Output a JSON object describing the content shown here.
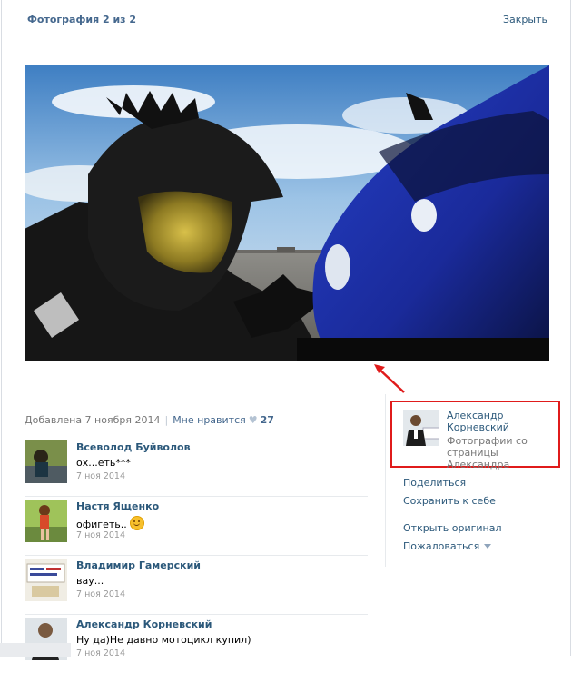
{
  "header": {
    "title": "Фотография 2 из 2",
    "close_label": "Закрыть"
  },
  "meta": {
    "added": "Добавлена 7 ноября 2014",
    "like_label": "Мне нравится",
    "like_count": "27",
    "heart_icon": "heart-icon"
  },
  "comments": [
    {
      "name": "Всеволод Буйволов",
      "text": "ох...еть***",
      "date": "7 ноя 2014"
    },
    {
      "name": "Настя Ященко",
      "text": "офигеть..",
      "date": "7 ноя 2014",
      "emoji": "smile-emoji"
    },
    {
      "name": "Владимир Гамерский",
      "text": "вау...",
      "date": "7 ноя 2014"
    },
    {
      "name": "Александр Корневский",
      "text": "Ну да)Не давно мотоцикл купил)",
      "date": "7 ноя 2014"
    }
  ],
  "owner": {
    "name": "Александр Корневский",
    "from": "Фотографии со страницы Александра"
  },
  "actions": {
    "share": "Поделиться",
    "save": "Сохранить к себе",
    "original": "Открыть оригинал",
    "report": "Пожаловаться"
  },
  "colors": {
    "link": "#2b587a",
    "title": "#45688e",
    "highlight": "#e01b1b"
  }
}
